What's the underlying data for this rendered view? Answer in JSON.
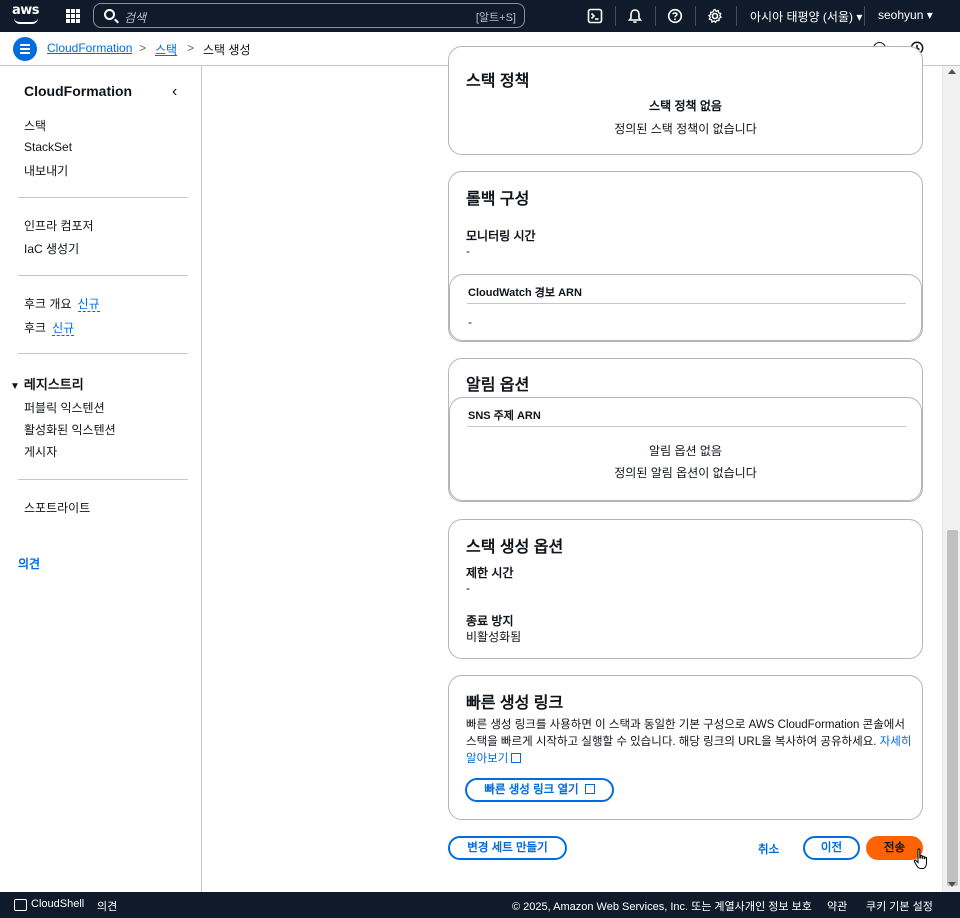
{
  "topnav": {
    "logo": "aws",
    "search_placeholder": "검색",
    "search_shortcut": "[알트+S]",
    "region": "아시아 태평양 (서울) ▾",
    "user": "seohyun ▾"
  },
  "breadcrumb": {
    "items": [
      "CloudFormation",
      "스택"
    ],
    "current": "스택 생성"
  },
  "sidebar": {
    "title": "CloudFormation",
    "group1": [
      "스택",
      "StackSet",
      "내보내기"
    ],
    "group2": [
      "인프라 컴포저",
      "IaC 생성기"
    ],
    "hooks_overview": "후크 개요",
    "hooks": "후크",
    "new_badge": "신규",
    "registry_title": "레지스트리",
    "registry_items": [
      "퍼블릭 익스텐션",
      "활성화된 익스텐션",
      "게시자"
    ],
    "spotlight": "스포트라이트",
    "feedback": "의견"
  },
  "stack_policy": {
    "title": "스택 정책",
    "empty_title": "스택 정책 없음",
    "empty_desc": "정의된 스택 정책이 없습니다"
  },
  "rollback": {
    "title": "롤백 구성",
    "monitoring_label": "모니터링 시간",
    "monitoring_value": "-",
    "alarm_header": "CloudWatch 경보 ARN",
    "alarm_value": "-"
  },
  "notifications": {
    "title": "알림 옵션",
    "sns_header": "SNS 주제 ARN",
    "empty_title": "알림 옵션 없음",
    "empty_desc": "정의된 알림 옵션이 없습니다"
  },
  "stack_options": {
    "title": "스택 생성 옵션",
    "timeout_label": "제한 시간",
    "timeout_value": "-",
    "termination_label": "종료 방지",
    "termination_value": "비활성화됨"
  },
  "quick_link": {
    "title": "빠른 생성 링크",
    "desc": "빠른 생성 링크를 사용하면 이 스택과 동일한 기본 구성으로 AWS CloudFormation 콘솔에서 스택을 빠르게 시작하고 실행할 수 있습니다. 해당 링크의 URL을 복사하여 공유하세요.",
    "learn_more": "자세히 알아보기",
    "open_button": "빠른 생성 링크 열기"
  },
  "actions": {
    "change_set": "변경 세트 만들기",
    "cancel": "취소",
    "previous": "이전",
    "submit": "전송"
  },
  "footer": {
    "cloudshell": "CloudShell",
    "feedback": "의견",
    "copyright": "© 2025, Amazon Web Services, Inc. 또는 계열사.",
    "privacy": "개인 정보 보호",
    "terms": "약관",
    "cookies": "쿠키 기본 설정"
  },
  "colors": {
    "nav_bg": "#0f1b2a",
    "link": "#006ce0",
    "primary": "#ff6200",
    "border": "#b4b4bb"
  }
}
